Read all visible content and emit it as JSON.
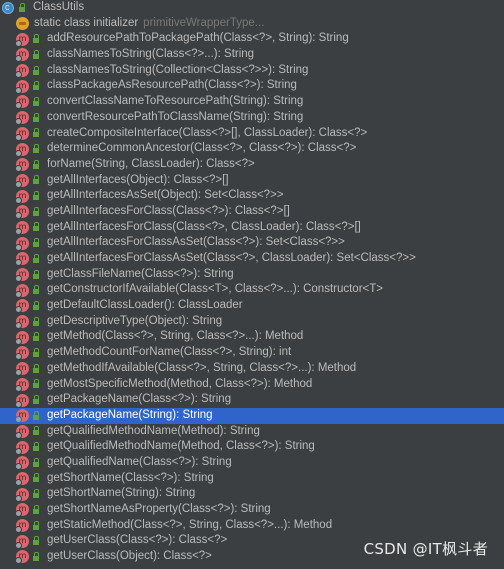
{
  "tree": {
    "root": {
      "label": "ClassUtils",
      "icon": "class-icon",
      "visibility_icon": "public-lock-icon"
    },
    "initializer": {
      "label": "static class initializer",
      "hint": "primitiveWrapperType...",
      "icon": "static-initializer-icon"
    },
    "selected_index": 24,
    "methods": [
      "addResourcePathToPackagePath(Class<?>, String): String",
      "classNamesToString(Class<?>...): String",
      "classNamesToString(Collection<Class<?>>): String",
      "classPackageAsResourcePath(Class<?>): String",
      "convertClassNameToResourcePath(String): String",
      "convertResourcePathToClassName(String): String",
      "createCompositeInterface(Class<?>[], ClassLoader): Class<?>",
      "determineCommonAncestor(Class<?>, Class<?>): Class<?>",
      "forName(String, ClassLoader): Class<?>",
      "getAllInterfaces(Object): Class<?>[]",
      "getAllInterfacesAsSet(Object): Set<Class<?>>",
      "getAllInterfacesForClass(Class<?>): Class<?>[]",
      "getAllInterfacesForClass(Class<?>, ClassLoader): Class<?>[]",
      "getAllInterfacesForClassAsSet(Class<?>): Set<Class<?>>",
      "getAllInterfacesForClassAsSet(Class<?>, ClassLoader): Set<Class<?>>",
      "getClassFileName(Class<?>): String",
      "getConstructorIfAvailable(Class<T>, Class<?>...): Constructor<T>",
      "getDefaultClassLoader(): ClassLoader",
      "getDescriptiveType(Object): String",
      "getMethod(Class<?>, String, Class<?>...): Method",
      "getMethodCountForName(Class<?>, String): int",
      "getMethodIfAvailable(Class<?>, String, Class<?>...): Method",
      "getMostSpecificMethod(Method, Class<?>): Method",
      "getPackageName(Class<?>): String",
      "getPackageName(String): String",
      "getQualifiedMethodName(Method): String",
      "getQualifiedMethodName(Method, Class<?>): String",
      "getQualifiedName(Class<?>): String",
      "getShortName(Class<?>): String",
      "getShortName(String): String",
      "getShortNameAsProperty(Class<?>): String",
      "getStaticMethod(Class<?>, String, Class<?>...): Method",
      "getUserClass(Class<?>): Class<?>",
      "getUserClass(Object): Class<?>"
    ],
    "method_icon_glyph": "m"
  },
  "watermark": "CSDN @IT枫斗者",
  "colors": {
    "background": "#3c3f41",
    "selection": "#2f65ca",
    "method_icon": "#d9676d",
    "lock_icon": "#5ca340"
  }
}
